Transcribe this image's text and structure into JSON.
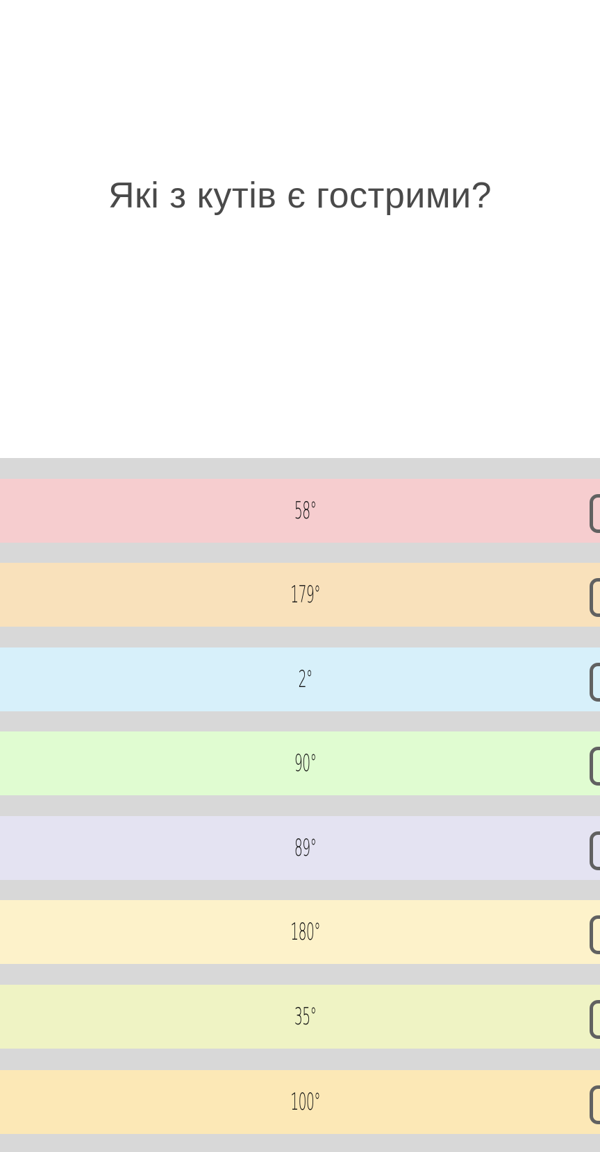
{
  "question": {
    "text": "Які з кутів є гострими?"
  },
  "options": [
    {
      "label": "58°",
      "color": "#f6cdcf"
    },
    {
      "label": "179°",
      "color": "#f9e1bb"
    },
    {
      "label": "2°",
      "color": "#d7f0fa"
    },
    {
      "label": "90°",
      "color": "#e0fcd1"
    },
    {
      "label": "89°",
      "color": "#e4e3f2"
    },
    {
      "label": "180°",
      "color": "#fdf2ca"
    },
    {
      "label": "35°",
      "color": "#eff3c4"
    },
    {
      "label": "100°",
      "color": "#fce8b6"
    }
  ]
}
